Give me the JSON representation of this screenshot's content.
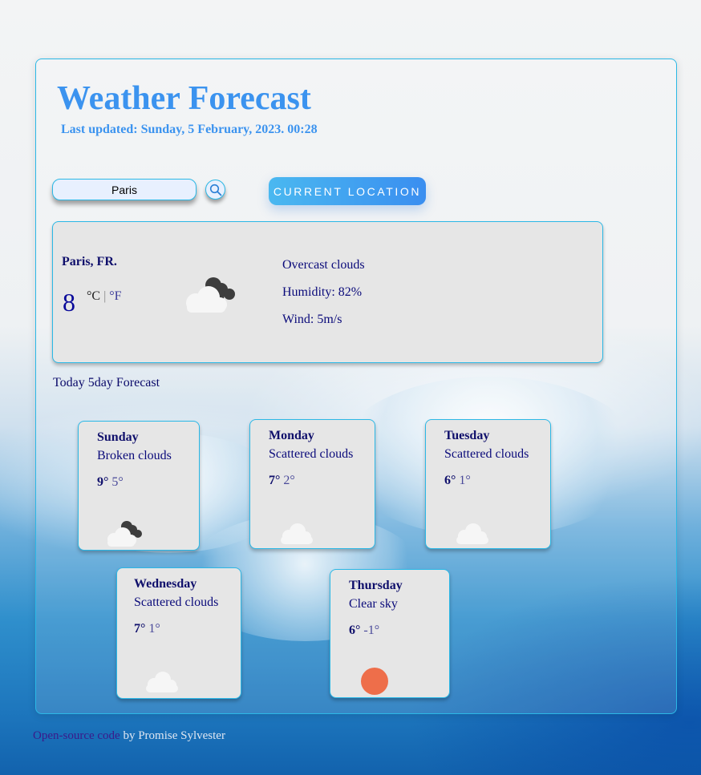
{
  "header": {
    "title": "Weather Forecast",
    "last_updated": "Last updated: Sunday, 5 February, 2023. 00:28"
  },
  "search": {
    "value": "Paris",
    "button_icon": "search-icon",
    "location_button": "CURRENT LOCATION"
  },
  "current": {
    "city": "Paris, FR.",
    "temperature": "8",
    "unit_c": "°C",
    "unit_sep": "|",
    "unit_f": "°F",
    "icon": "cloud-overcast-icon",
    "description": "Overcast clouds",
    "humidity": "Humidity: 82%",
    "wind": "Wind: 5m/s"
  },
  "forecast_label": "Today 5day Forecast",
  "forecast": [
    {
      "day": "Sunday",
      "desc": "Broken clouds",
      "hi": "9°",
      "lo": "5°",
      "icon": "cloud-broken-icon"
    },
    {
      "day": "Monday",
      "desc": "Scattered clouds",
      "hi": "7°",
      "lo": "2°",
      "icon": "cloud-scattered-icon"
    },
    {
      "day": "Tuesday",
      "desc": "Scattered clouds",
      "hi": "6°",
      "lo": "1°",
      "icon": "cloud-scattered-icon"
    },
    {
      "day": "Wednesday",
      "desc": "Scattered clouds",
      "hi": "7°",
      "lo": "1°",
      "icon": "cloud-scattered-icon"
    },
    {
      "day": "Thursday",
      "desc": "Clear sky",
      "hi": "6°",
      "lo": "-1°",
      "icon": "sun-icon"
    }
  ],
  "footer": {
    "link_text": "Open-source code",
    "by_text": " by Promise Sylvester"
  },
  "colors": {
    "accent": "#3b93ef",
    "border": "#2bb8e6",
    "sun": "#ee6e4a"
  }
}
